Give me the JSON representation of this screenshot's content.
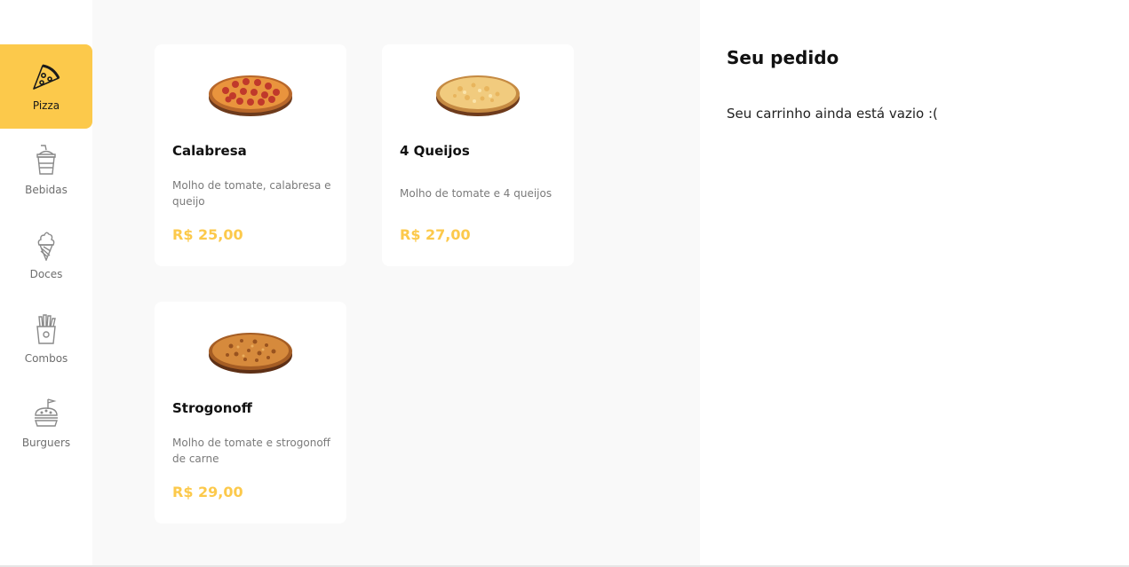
{
  "sidebar": {
    "items": [
      {
        "label": "Pizza",
        "icon": "pizza-icon",
        "active": true
      },
      {
        "label": "Bebidas",
        "icon": "drink-icon",
        "active": false
      },
      {
        "label": "Doces",
        "icon": "ice-cream-icon",
        "active": false
      },
      {
        "label": "Combos",
        "icon": "fries-icon",
        "active": false
      },
      {
        "label": "Burguers",
        "icon": "burger-icon",
        "active": false
      }
    ]
  },
  "products": [
    {
      "name": "Calabresa",
      "description": "Molho de tomate, calabresa e queijo",
      "price": "R$ 25,00",
      "image": "pepperoni-pizza-image"
    },
    {
      "name": "4 Queijos",
      "description": "Molho de tomate e 4 queijos",
      "price": "R$ 27,00",
      "image": "cheese-pizza-image"
    },
    {
      "name": "Strogonoff",
      "description": "Molho de tomate e strogonoff de carne",
      "price": "R$ 29,00",
      "image": "strogonoff-pizza-image"
    }
  ],
  "cart": {
    "title": "Seu pedido",
    "empty_message": "Seu carrinho ainda está vazio :("
  },
  "colors": {
    "accent": "#fcc94b",
    "main_bg": "#f9f9f9",
    "card_bg": "#ffffff"
  }
}
